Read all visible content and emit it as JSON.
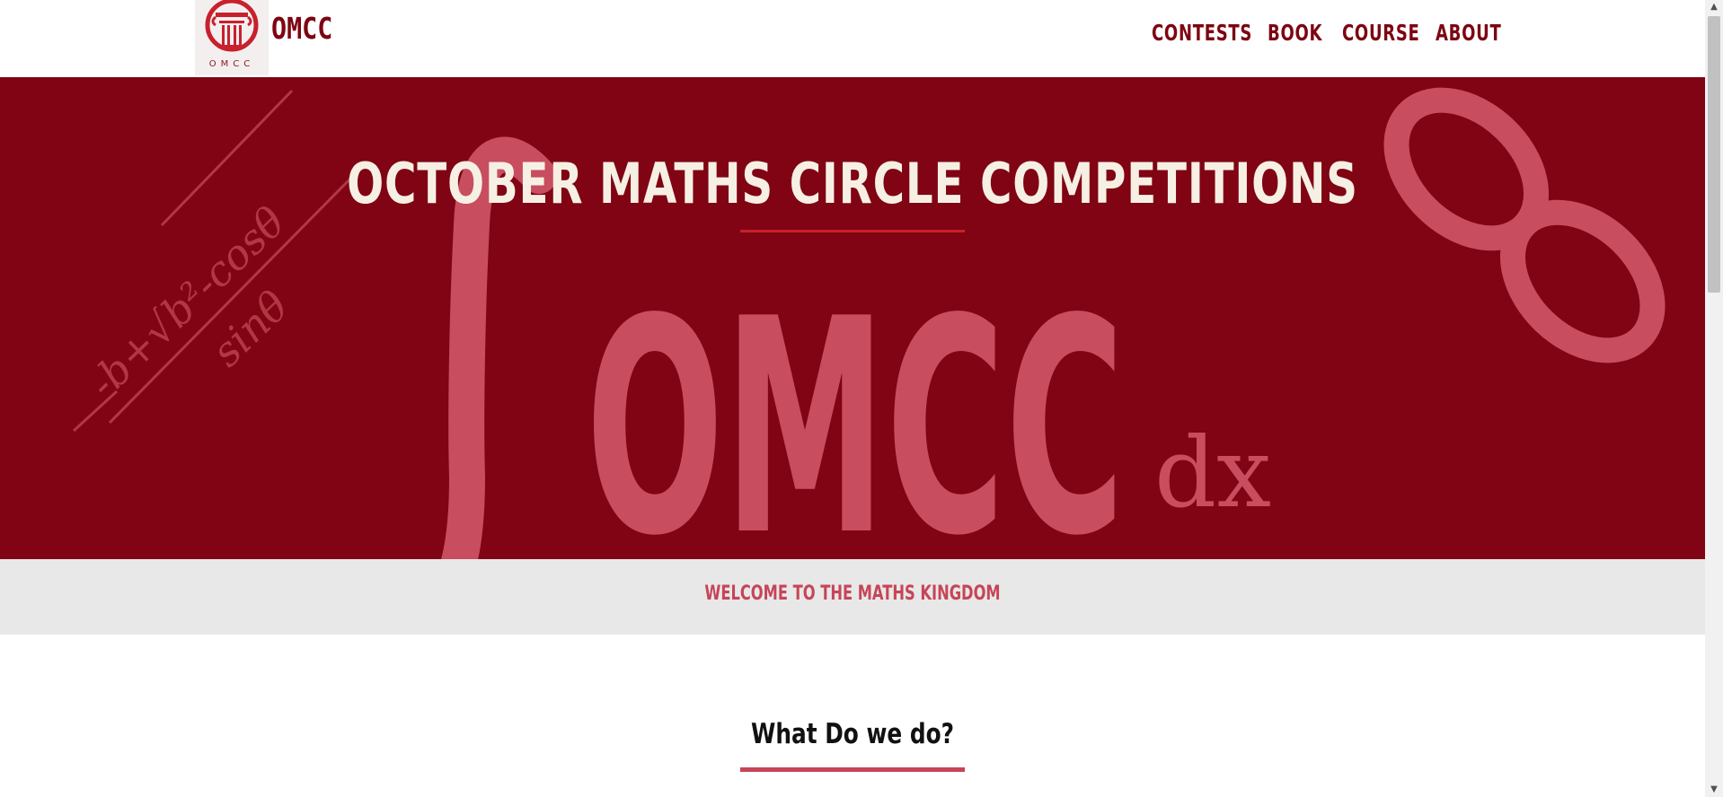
{
  "header": {
    "brand": "OMCC",
    "logo_caption": "OMCC",
    "nav": [
      {
        "label": "CONTESTS"
      },
      {
        "label": "BOOK"
      },
      {
        "label": "COURSE"
      },
      {
        "label": "ABOUT"
      }
    ]
  },
  "hero": {
    "title": "OCTOBER MATHS CIRCLE COMPETITIONS",
    "watermark_text": "OMCC",
    "watermark_suffix": "dx",
    "formula_top": "-b+√b²-cosθ",
    "formula_bottom": "sinθ"
  },
  "welcome": {
    "text": "WELCOME TO THE MATHS KINGDOM"
  },
  "section": {
    "title": "What Do we do?"
  },
  "scrollbar": {
    "up_icon": "▲",
    "down_icon": "▼"
  },
  "colors": {
    "brand": "#7d0512",
    "hero_bg": "#800413",
    "accent": "#c64558"
  }
}
